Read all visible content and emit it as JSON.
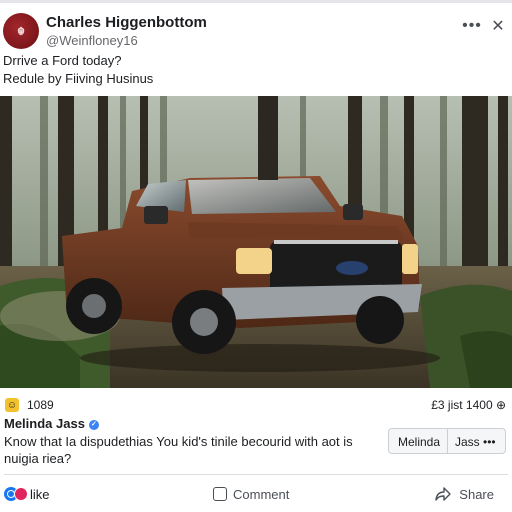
{
  "post": {
    "author": "Charles Higgenbottom",
    "handle": "@Weinfloney16",
    "avatar_text": "☬",
    "line1": "Drrive a Ford today?",
    "line2": "Redule by Fiiving Husinus",
    "more_icon": "more-horizontal-icon",
    "close_icon": "close-icon",
    "image_subject": "pickup-truck-in-forest"
  },
  "stats": {
    "reaction_icon": "laughing-emoji-icon",
    "reaction_count": "1089",
    "right": "£3 jist 1400 ⊕"
  },
  "comment": {
    "author": "Melinda Jass",
    "text": "Know that Ia dispudethias You kid's tinile becourid with aot is nuigia riea?",
    "chip_left": "Melinda",
    "chip_right": "Jass •••"
  },
  "actions": {
    "like_label": "like",
    "comment_label": "Comment",
    "share_label": "Share"
  },
  "colors": {
    "accent": "#1877f2",
    "reaction_yellow": "#f2c12e",
    "avatar_red": "#a2262c",
    "divider": "#dadde1"
  }
}
